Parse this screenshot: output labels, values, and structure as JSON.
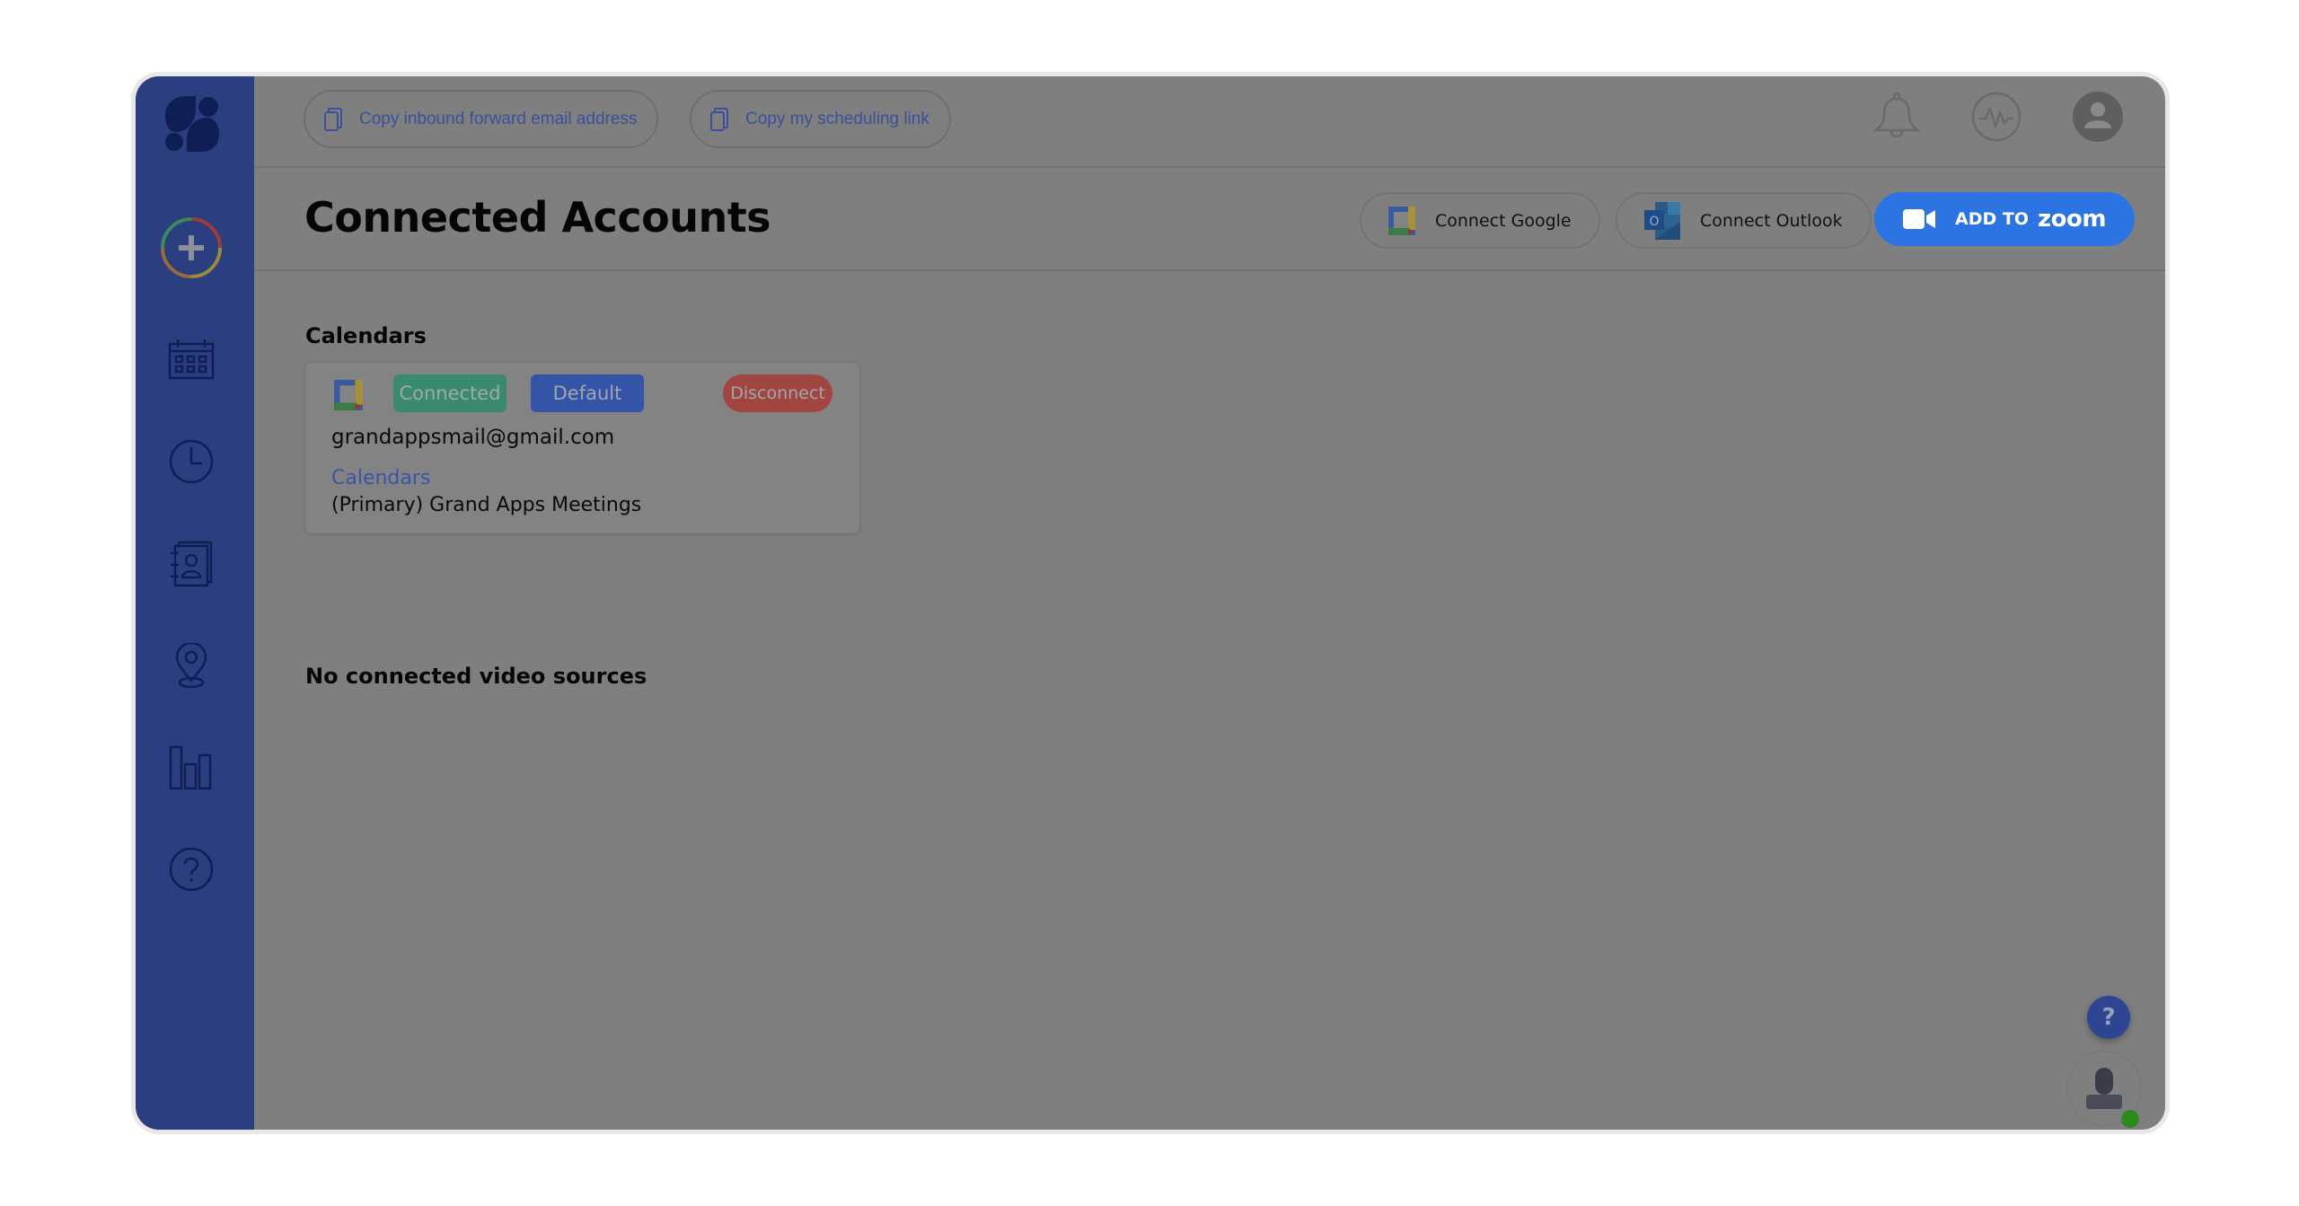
{
  "topbar": {
    "copy_forward_email": "Copy inbound forward email address",
    "copy_scheduling_link": "Copy my scheduling link",
    "icons": [
      "bell-icon",
      "activity-icon",
      "user-avatar-icon"
    ]
  },
  "sidebar": {
    "logo": "app-logo",
    "items": [
      {
        "name": "create",
        "icon": "plus-icon"
      },
      {
        "name": "calendar",
        "icon": "calendar-icon"
      },
      {
        "name": "history",
        "icon": "clock-icon"
      },
      {
        "name": "contacts",
        "icon": "contacts-icon"
      },
      {
        "name": "locations",
        "icon": "location-pin-icon"
      },
      {
        "name": "reports",
        "icon": "bar-chart-icon"
      },
      {
        "name": "help",
        "icon": "help-icon"
      }
    ]
  },
  "page": {
    "title": "Connected Accounts",
    "connect_google": "Connect Google",
    "connect_outlook": "Connect Outlook",
    "add_to_zoom_prefix": "ADD TO",
    "add_to_zoom_brand": "zoom"
  },
  "calendars": {
    "heading": "Calendars",
    "accounts": [
      {
        "provider": "Google Calendar",
        "status": "Connected",
        "default_label": "Default",
        "disconnect_label": "Disconnect",
        "email": "grandappsmail@gmail.com",
        "calendars_link": "Calendars",
        "calendar_name": "(Primary) Grand Apps Meetings"
      }
    ]
  },
  "video": {
    "empty_message": "No connected video sources"
  },
  "floating": {
    "help_label": "?"
  },
  "colors": {
    "sidebar": "#2b3f80",
    "zoom_button": "#2d74e3",
    "connected_badge": "#3a8a6e",
    "default_badge": "#3454a8",
    "disconnect_badge": "#a04540",
    "online_status": "#2f8a1e"
  }
}
